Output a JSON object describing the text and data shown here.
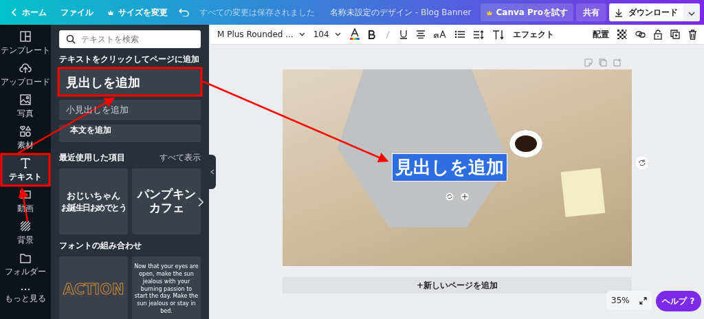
{
  "topbar": {
    "home": "ホーム",
    "file": "ファイル",
    "resize": "サイズを変更",
    "save_status": "すべての変更は保存されました",
    "title": "名称未設定のデザイン - Blog Banner",
    "pro_button": "Canva Proを試す",
    "share": "共有",
    "download": "ダウンロード"
  },
  "rail": [
    {
      "label": "テンプレート",
      "selected": false
    },
    {
      "label": "アップロード",
      "selected": false
    },
    {
      "label": "写真",
      "selected": false
    },
    {
      "label": "素材",
      "selected": false
    },
    {
      "label": "テキスト",
      "selected": true
    },
    {
      "label": "動画",
      "selected": false
    },
    {
      "label": "背景",
      "selected": false
    },
    {
      "label": "フォルダー",
      "selected": false
    },
    {
      "label": "もっと見る",
      "selected": false
    }
  ],
  "panel": {
    "search_placeholder": "テキストを検索",
    "section_title": "テキストをクリックしてページに追加",
    "text_buttons": [
      {
        "kind": "heading",
        "label": "見出しを追加"
      },
      {
        "kind": "subheading",
        "label": "小見出しを追加"
      },
      {
        "kind": "body",
        "label": "本文を追加"
      }
    ],
    "recent": {
      "title": "最近使用した項目",
      "see_all": "すべて表示",
      "cards": [
        {
          "kind": "handwritten",
          "lines": [
            "おじいちゃん",
            "お誕生日おめでとう"
          ]
        },
        {
          "kind": "bold",
          "lines": [
            "パンプキン",
            "カフェ"
          ]
        }
      ]
    },
    "combos": {
      "title": "フォントの組み合わせ",
      "cards": [
        {
          "kind": "outline",
          "lines": [
            "ACTION"
          ]
        },
        {
          "kind": "paragraph",
          "lines": [
            "Now that your eyes are open, make the sun jealous with your burning passion to start the day. Make the sun jealous or stay in bed."
          ]
        }
      ]
    }
  },
  "toolbar": {
    "font": "M Plus Rounded ...",
    "size": "104",
    "effects": "エフェクト",
    "position": "配置"
  },
  "canvas": {
    "selected_text": "見出しを追加",
    "add_page": "+新しいページを追加"
  },
  "zoom": "35%",
  "help": "ヘルプ ?"
}
